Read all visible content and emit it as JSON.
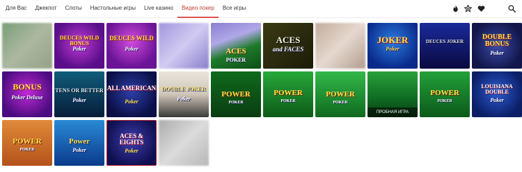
{
  "tabs": [
    {
      "label": "Для Вас",
      "active": false
    },
    {
      "label": "Джекпот",
      "active": false
    },
    {
      "label": "Слоты",
      "active": false
    },
    {
      "label": "Настольные игры",
      "active": false
    },
    {
      "label": "Live казино",
      "active": false
    },
    {
      "label": "Видео покер",
      "active": true
    },
    {
      "label": "Все игры",
      "active": false
    }
  ],
  "header_icons": [
    "fire-icon",
    "star-badge-icon",
    "heart-icon",
    "search-icon"
  ],
  "colors": {
    "active_tab": "#d9534f",
    "text": "#333333"
  },
  "games": {
    "row1": [
      {
        "name": "",
        "line2": ""
      },
      {
        "name": "DEUCES WILD BONUS",
        "line2": "Poker"
      },
      {
        "name": "DEUCES WILD",
        "line2": "Poker"
      },
      {
        "name": "",
        "line2": ""
      },
      {
        "name": "ACES",
        "line2": "POKER"
      },
      {
        "name": "ACES",
        "line2": "and FACES"
      },
      {
        "name": "",
        "line2": ""
      },
      {
        "name": "JOKER",
        "line2": "Poker"
      },
      {
        "name": "DEUCES JOKER",
        "line2": ""
      },
      {
        "name": "DOUBLE BONUS",
        "line2": "Poker"
      }
    ],
    "row2": [
      {
        "name": "BONUS",
        "line2": "Poker Deluxe"
      },
      {
        "name": "TENS OR BETTER",
        "line2": "Poker"
      },
      {
        "name": "ALL AMERICAN",
        "line2": "Poker"
      },
      {
        "name": "DOUBLE JOKER",
        "line2": "Poker"
      },
      {
        "name": "POWER",
        "line2": "POKER"
      },
      {
        "name": "POWER",
        "line2": "POKER"
      },
      {
        "name": "POWER",
        "line2": "POKER"
      },
      {
        "name": "",
        "line2": "",
        "caption": "ПРОБНАЯ ИГРА"
      },
      {
        "name": "POWER",
        "line2": "POKER"
      },
      {
        "name": "LOUISIANA DOUBLE",
        "line2": "Poker"
      }
    ],
    "row3": [
      {
        "name": "POWER",
        "line2": "POKER"
      },
      {
        "name": "Power",
        "line2": "Poker"
      },
      {
        "name": "ACES & EIGHTS",
        "line2": "Poker"
      },
      {
        "name": "",
        "line2": ""
      }
    ]
  }
}
